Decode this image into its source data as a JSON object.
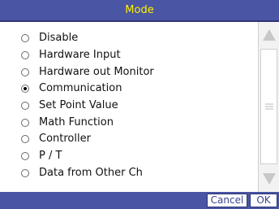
{
  "dialog": {
    "title": "Mode"
  },
  "options": [
    {
      "label": "Disable",
      "selected": false
    },
    {
      "label": "Hardware Input",
      "selected": false
    },
    {
      "label": "Hardware out Monitor",
      "selected": false
    },
    {
      "label": "Communication",
      "selected": true
    },
    {
      "label": "Set Point Value",
      "selected": false
    },
    {
      "label": "Math Function",
      "selected": false
    },
    {
      "label": "Controller",
      "selected": false
    },
    {
      "label": "P / T",
      "selected": false
    },
    {
      "label": "Data from Other Ch",
      "selected": false
    }
  ],
  "buttons": {
    "cancel_label": "Cancel",
    "ok_label": "OK"
  },
  "colors": {
    "title_bar": "#4a55a3",
    "title_text": "#fff200",
    "scroll_arrow": "#c8c8c8"
  },
  "icons": {
    "scroll_up": "triangle-up-icon",
    "scroll_down": "triangle-down-icon",
    "thumb_grip": "grip-lines-icon"
  }
}
